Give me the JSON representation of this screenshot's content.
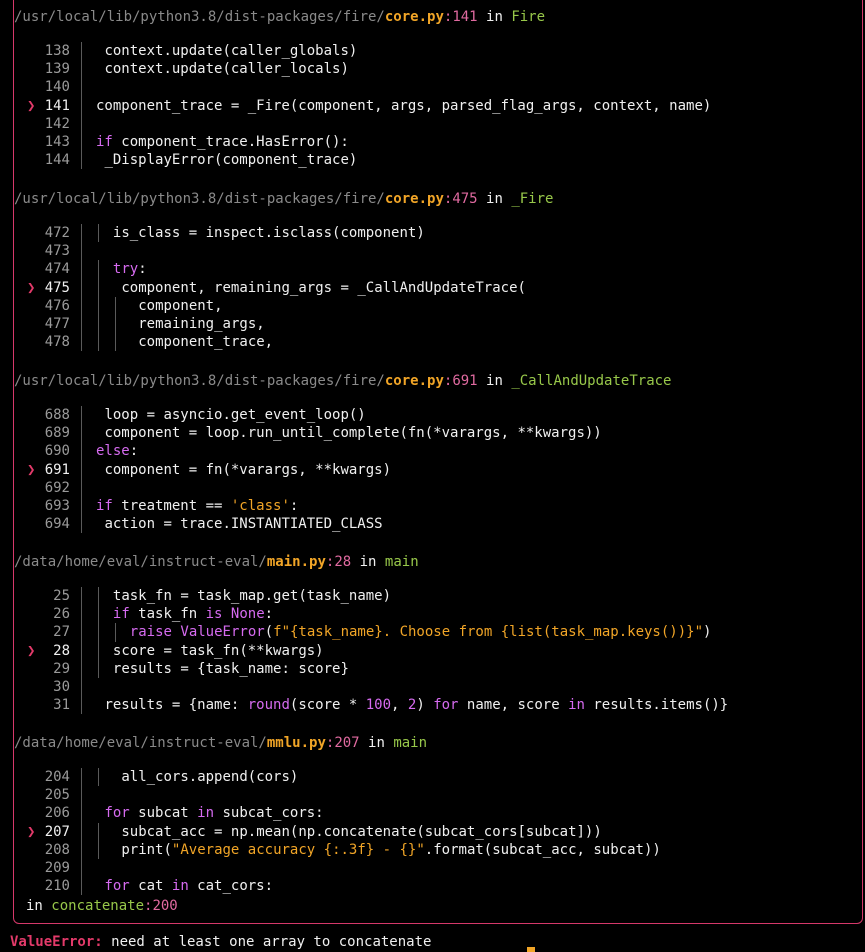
{
  "frames": [
    {
      "path": "/usr/local/lib/python3.8/dist-packages/fire/",
      "file": "core.py",
      "line": ":141",
      "in_word": " in ",
      "func": "Fire",
      "lines": [
        {
          "n": "138",
          "code": "context.update(caller_globals)",
          "indent": 1
        },
        {
          "n": "139",
          "code": "context.update(caller_locals)",
          "indent": 1
        },
        {
          "n": "140",
          "code": "",
          "indent": 0
        },
        {
          "n": "141",
          "code": "component_trace = _Fire(component, args, parsed_flag_args, context, name)",
          "indent": 0,
          "current": true
        },
        {
          "n": "142",
          "code": "",
          "indent": 0
        },
        {
          "n": "143",
          "code": "if component_trace.HasError():",
          "indent": 0
        },
        {
          "n": "144",
          "code": "_DisplayError(component_trace)",
          "indent": 1
        }
      ]
    },
    {
      "path": "/usr/local/lib/python3.8/dist-packages/fire/",
      "file": "core.py",
      "line": ":475",
      "in_word": " in ",
      "func": "_Fire",
      "lines": [
        {
          "n": "472",
          "code": "is_class = inspect.isclass(component)",
          "indent": 2
        },
        {
          "n": "473",
          "code": "",
          "indent": 0
        },
        {
          "n": "474",
          "code": "try:",
          "indent": 2
        },
        {
          "n": "475",
          "code": "component, remaining_args = _CallAndUpdateTrace(",
          "indent": 3,
          "current": true
        },
        {
          "n": "476",
          "code": "component,",
          "indent": 5
        },
        {
          "n": "477",
          "code": "remaining_args,",
          "indent": 5
        },
        {
          "n": "478",
          "code": "component_trace,",
          "indent": 5
        }
      ]
    },
    {
      "path": "/usr/local/lib/python3.8/dist-packages/fire/",
      "file": "core.py",
      "line": ":691",
      "in_word": " in ",
      "func": "_CallAndUpdateTrace",
      "lines": [
        {
          "n": "688",
          "code": "loop = asyncio.get_event_loop()",
          "indent": 1
        },
        {
          "n": "689",
          "code": "component = loop.run_until_complete(fn(*varargs, **kwargs))",
          "indent": 1
        },
        {
          "n": "690",
          "code": "else:",
          "indent": 0
        },
        {
          "n": "691",
          "code": "component = fn(*varargs, **kwargs)",
          "indent": 1,
          "current": true
        },
        {
          "n": "692",
          "code": "",
          "indent": 0
        },
        {
          "n": "693",
          "code": "if treatment == 'class':",
          "indent": 0
        },
        {
          "n": "694",
          "code": "action = trace.INSTANTIATED_CLASS",
          "indent": 1
        }
      ]
    },
    {
      "path": "/data/home/eval/instruct-eval/",
      "file": "main.py",
      "line": ":28",
      "in_word": " in ",
      "func": "main",
      "lines": [
        {
          "n": "25",
          "code": "task_fn = task_map.get(task_name)",
          "indent": 2
        },
        {
          "n": "26",
          "code": "if task_fn is None:",
          "indent": 2
        },
        {
          "n": "27",
          "code": "raise ValueError(f\"{task_name}. Choose from {list(task_map.keys())}\")",
          "indent": 4
        },
        {
          "n": "28",
          "code": "score = task_fn(**kwargs)",
          "indent": 2,
          "current": true
        },
        {
          "n": "29",
          "code": "results = {task_name: score}",
          "indent": 2
        },
        {
          "n": "30",
          "code": "",
          "indent": 0
        },
        {
          "n": "31",
          "code": "results = {name: round(score * 100, 2) for name, score in results.items()}",
          "indent": 1
        }
      ]
    },
    {
      "path": "/data/home/eval/instruct-eval/",
      "file": "mmlu.py",
      "line": ":207",
      "in_word": " in ",
      "func": "main",
      "lines": [
        {
          "n": "204",
          "code": "all_cors.append(cors)",
          "indent": 3
        },
        {
          "n": "205",
          "code": "",
          "indent": 0
        },
        {
          "n": "206",
          "code": "for subcat in subcat_cors:",
          "indent": 1
        },
        {
          "n": "207",
          "code": "subcat_acc = np.mean(np.concatenate(subcat_cors[subcat]))",
          "indent": 3,
          "current": true
        },
        {
          "n": "208",
          "code": "print(\"Average accuracy {:.3f} - {}\".format(subcat_acc, subcat))",
          "indent": 3
        },
        {
          "n": "209",
          "code": "",
          "indent": 0
        },
        {
          "n": "210",
          "code": "for cat in cat_cors:",
          "indent": 1
        }
      ]
    }
  ],
  "tail": {
    "prefix": "in ",
    "func": "concatenate",
    "line": ":200"
  },
  "error": {
    "type": "ValueError:",
    "message": " need at least one array to concatenate"
  },
  "arrow_glyph": "❯",
  "colors": {
    "border": "#d5386a",
    "keyword": "#d66bf0",
    "string": "#f1a527",
    "function": "#98c84a",
    "path": "#8a8a8a"
  }
}
